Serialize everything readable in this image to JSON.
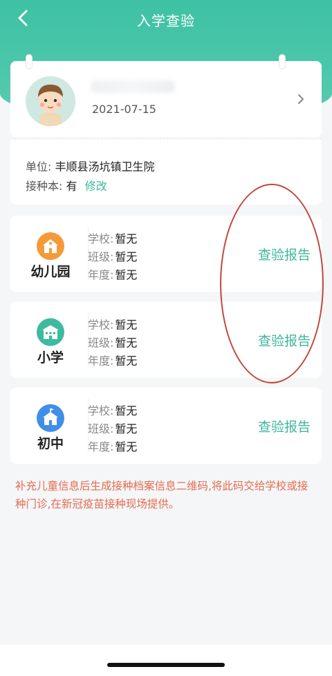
{
  "nav": {
    "title": "入学查验",
    "back_icon": "back-arrow-icon"
  },
  "profile": {
    "birthdate": "2021-07-15",
    "chevron_icon": "chevron-right-icon"
  },
  "info": {
    "unit_label": "单位:",
    "unit_value": "丰顺县汤坑镇卫生院",
    "book_label": "接种本:",
    "book_value": "有",
    "edit_label": "修改"
  },
  "schools": [
    {
      "label": "幼儿园",
      "icon": "kindergarten-icon",
      "color": "#f59a38",
      "school_label": "学校:",
      "school_value": "暂无",
      "class_label": "班级:",
      "class_value": "暂无",
      "year_label": "年度:",
      "year_value": "暂无",
      "report_label": "查验报告"
    },
    {
      "label": "小学",
      "icon": "primary-school-icon",
      "color": "#3dbb9f",
      "school_label": "学校:",
      "school_value": "暂无",
      "class_label": "班级:",
      "class_value": "暂无",
      "year_label": "年度:",
      "year_value": "暂无",
      "report_label": "查验报告"
    },
    {
      "label": "初中",
      "icon": "middle-school-icon",
      "color": "#3f8fe8",
      "school_label": "学校:",
      "school_value": "暂无",
      "class_label": "班级:",
      "class_value": "暂无",
      "year_label": "年度:",
      "year_value": "暂无",
      "report_label": "查验报告"
    }
  ],
  "note": "补充儿童信息后生成接种档案信息二维码,将此码交给学校或接种门诊,在新冠疫苗接种现场提供。",
  "colors": {
    "header": "#46c4a8",
    "accent": "#3fb69c",
    "note": "#e36d4e",
    "annotation": "#c0473a"
  }
}
